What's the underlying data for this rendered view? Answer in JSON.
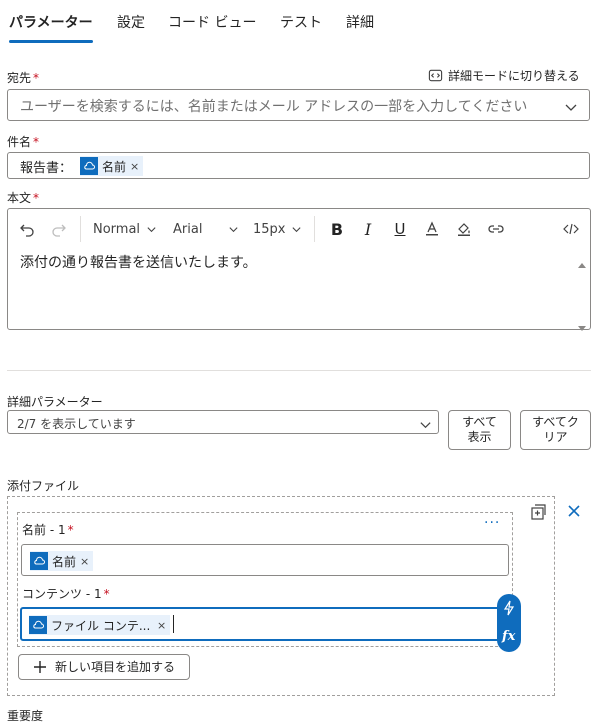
{
  "tabs": [
    {
      "label": "パラメーター",
      "active": true
    },
    {
      "label": "設定",
      "active": false
    },
    {
      "label": "コード ビュー",
      "active": false
    },
    {
      "label": "テスト",
      "active": false
    },
    {
      "label": "詳細",
      "active": false
    }
  ],
  "to": {
    "label": "宛先",
    "required_mark": "*",
    "advanced_mode_link": "詳細モードに切り替える",
    "placeholder": "ユーザーを検索するには、名前またはメール アドレスの一部を入力してください"
  },
  "subject": {
    "label": "件名",
    "required_mark": "*",
    "prefix": "報告書：",
    "token_label": "名前"
  },
  "body": {
    "label": "本文",
    "required_mark": "*",
    "format_select": "Normal",
    "font_select": "Arial",
    "size_select": "15px",
    "text": "添付の通り報告書を送信いたします。"
  },
  "advanced_params": {
    "label": "詳細パラメーター",
    "select_value": "2/7 を表示しています",
    "show_all_button": "すべて\n表示",
    "clear_all_button": "すべてク\nリア"
  },
  "attachments": {
    "label": "添付ファイル",
    "name_label": "名前 - 1",
    "name_required_mark": "*",
    "name_token": "名前",
    "content_label": "コンテンツ - 1",
    "content_required_mark": "*",
    "content_token": "ファイル コンテ...",
    "add_item_button": "新しい項目を追加する",
    "more_menu": "···"
  },
  "importance": {
    "label": "重要度"
  },
  "colors": {
    "accent": "#0f6cbd",
    "required": "#c50f1f",
    "border": "#8a8886"
  }
}
